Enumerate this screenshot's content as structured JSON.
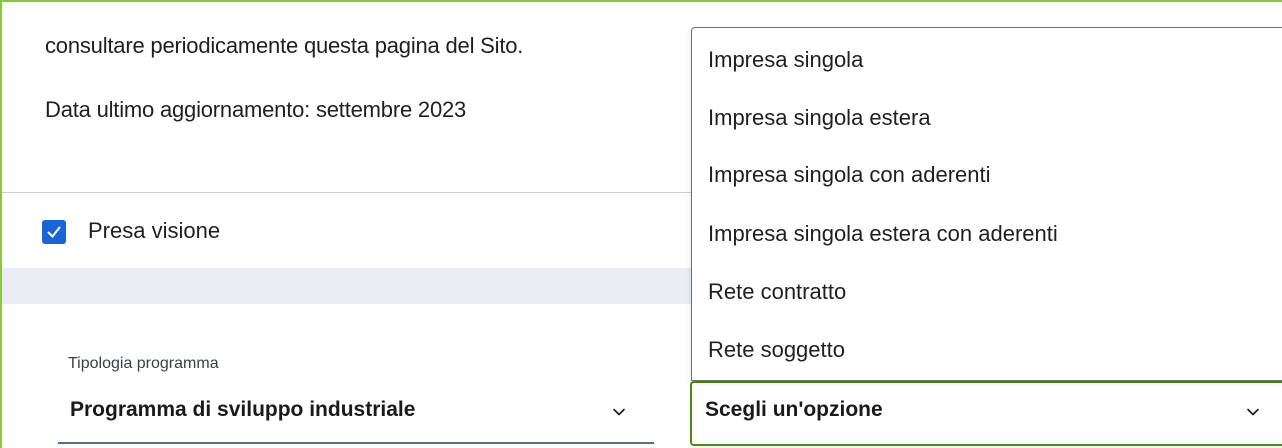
{
  "notice": {
    "line1": "consultare periodicamente questa pagina del Sito.",
    "line2": "Data ultimo aggiornamento: settembre 2023"
  },
  "acknowledge": {
    "label": "Presa visione",
    "checked": true
  },
  "program_type": {
    "label": "Tipologia programma",
    "value": "Programma di sviluppo industriale"
  },
  "subject_select": {
    "value": "Scegli un'opzione",
    "options": [
      "Impresa singola",
      "Impresa singola estera",
      "Impresa singola con aderenti",
      "Impresa singola estera con aderenti",
      "Rete contratto",
      "Rete soggetto"
    ]
  },
  "colors": {
    "accent_green": "#8cc63f",
    "checkbox_blue": "#1a64d6",
    "band_gray": "#eaeef4"
  }
}
